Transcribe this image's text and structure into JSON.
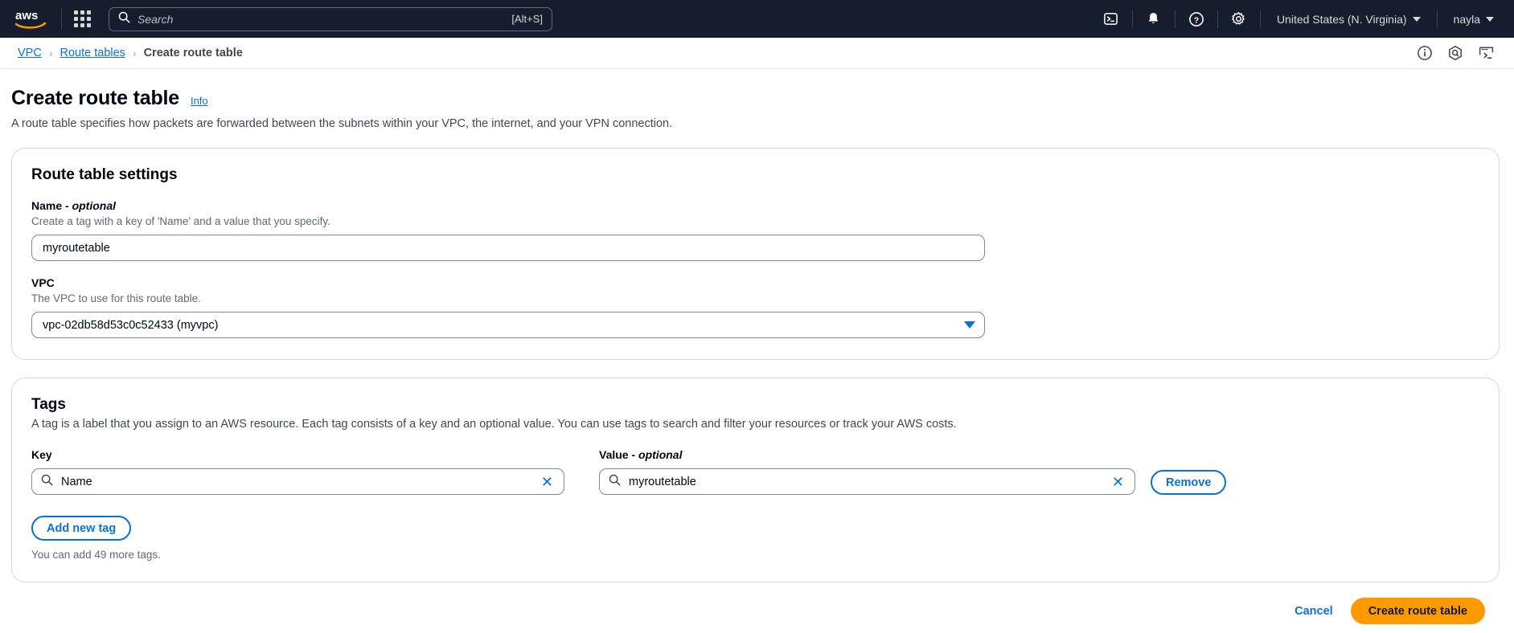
{
  "topnav": {
    "logo_alt": "aws",
    "apps_icon": "grid-icon",
    "search": {
      "placeholder": "Search",
      "shortcut": "[Alt+S]",
      "icon": "search-icon"
    },
    "icons": [
      {
        "name": "cloudshell-icon",
        "label": "CloudShell"
      },
      {
        "name": "bell-icon",
        "label": "Notifications"
      },
      {
        "name": "help-icon",
        "label": "Help"
      },
      {
        "name": "settings-gear-icon",
        "label": "Settings"
      }
    ],
    "region": "United States (N. Virginia)",
    "account": "nayla"
  },
  "breadcrumb": {
    "items": [
      {
        "label": "VPC",
        "current": false
      },
      {
        "label": "Route tables",
        "current": false
      },
      {
        "label": "Create route table",
        "current": true
      }
    ],
    "separator": "›",
    "right_icons": [
      {
        "name": "info-circle-icon"
      },
      {
        "name": "amazon-q-icon"
      },
      {
        "name": "cloudshell-icon"
      }
    ]
  },
  "page": {
    "title": "Create route table",
    "info_label": "Info",
    "description": "A route table specifies how packets are forwarded between the subnets within your VPC, the internet, and your VPN connection."
  },
  "settings": {
    "heading": "Route table settings",
    "name_field": {
      "label": "Name",
      "optional_suffix": "- optional",
      "hint": "Create a tag with a key of 'Name' and a value that you specify.",
      "value": "myroutetable",
      "placeholder": ""
    },
    "vpc_field": {
      "label": "VPC",
      "hint": "The VPC to use for this route table.",
      "value": "vpc-02db58d53c0c52433 (myvpc)"
    }
  },
  "tags": {
    "heading": "Tags",
    "description": "A tag is a label that you assign to an AWS resource. Each tag consists of a key and an optional value. You can use tags to search and filter your resources or track your AWS costs.",
    "key_label": "Key",
    "value_label": "Value",
    "value_optional_suffix": "- optional",
    "rows": [
      {
        "key": "Name",
        "value": "myroutetable",
        "remove_label": "Remove",
        "clear_glyph": "✕"
      }
    ],
    "add_button": "Add new tag",
    "note": "You can add 49 more tags."
  },
  "footer": {
    "cancel_label": "Cancel",
    "submit_label": "Create route table"
  },
  "colors": {
    "nav_bg": "#161e2d",
    "link": "#0972d3",
    "primary": "#ff9900"
  }
}
